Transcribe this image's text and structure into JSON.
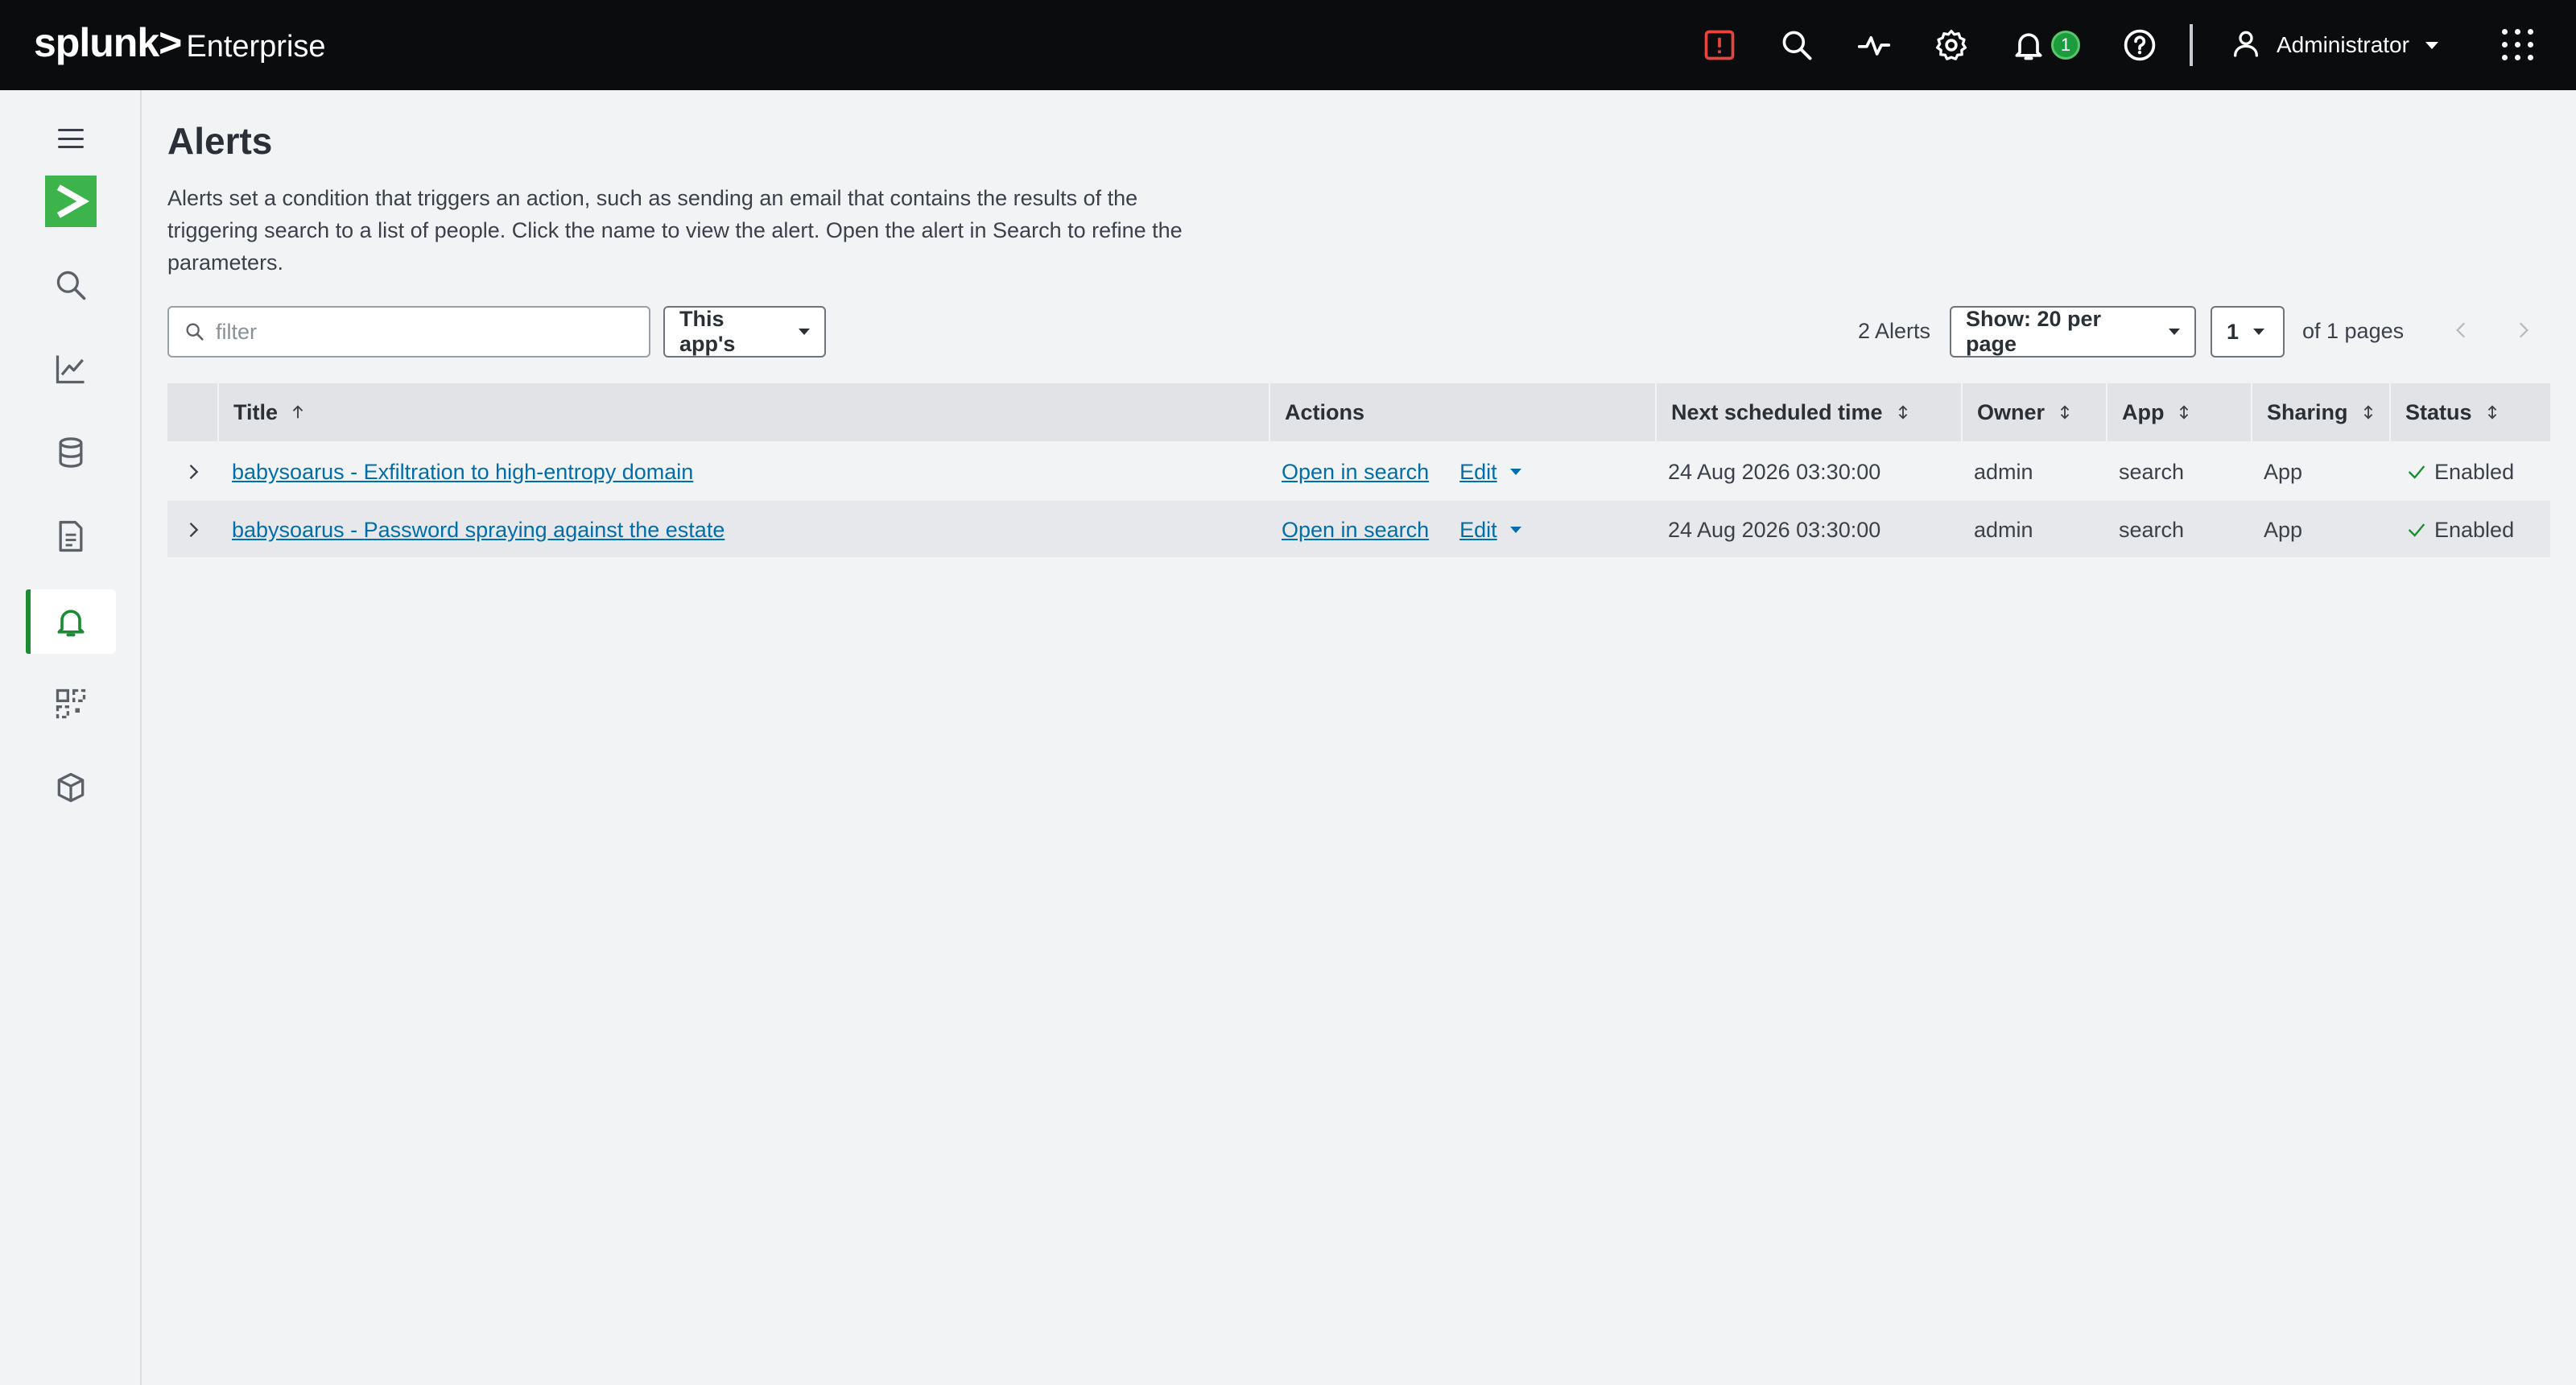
{
  "brand": {
    "logo": "splunk>",
    "product": "Enterprise"
  },
  "topbar": {
    "icons": [
      "alert-triangle-icon",
      "search-icon",
      "activity-icon",
      "gear-icon",
      "bell-icon",
      "help-icon"
    ],
    "notification_count": "1",
    "user_name": "Administrator"
  },
  "sidebar": {
    "items": [
      {
        "icon": "search-icon"
      },
      {
        "icon": "chart-icon"
      },
      {
        "icon": "database-icon"
      },
      {
        "icon": "document-icon"
      },
      {
        "icon": "bell-icon",
        "active": true
      },
      {
        "icon": "dashboard-grid-icon"
      },
      {
        "icon": "package-icon"
      }
    ]
  },
  "page": {
    "title": "Alerts",
    "description": "Alerts set a condition that triggers an action, such as sending an email that contains the results of the triggering search to a list of people. Click the name to view the alert. Open the alert in Search to refine the parameters."
  },
  "toolbar": {
    "filter_placeholder": "filter",
    "filter_value": "",
    "scope_label": "This app's",
    "alert_count": "2 Alerts",
    "per_page_label": "Show: 20 per page",
    "page_number": "1",
    "of_pages": "of 1 pages"
  },
  "table": {
    "headers": {
      "title": "Title",
      "actions": "Actions",
      "next_time": "Next scheduled time",
      "owner": "Owner",
      "app": "App",
      "sharing": "Sharing",
      "status": "Status"
    },
    "rows": [
      {
        "title": "babysoarus - Exfiltration to high-entropy domain",
        "open_label": "Open in search",
        "edit_label": "Edit",
        "next_time": "24 Aug 2026 03:30:00",
        "owner": "admin",
        "app": "search",
        "sharing": "App",
        "status": "Enabled"
      },
      {
        "title": "babysoarus - Password spraying against the estate",
        "open_label": "Open in search",
        "edit_label": "Edit",
        "next_time": "24 Aug 2026 03:30:00",
        "owner": "admin",
        "app": "search",
        "sharing": "App",
        "status": "Enabled"
      }
    ]
  },
  "colors": {
    "topbar_bg": "#0b0c0e",
    "accent_green": "#1c8c34",
    "link_blue": "#006eaa",
    "alert_red": "#e8453c"
  }
}
